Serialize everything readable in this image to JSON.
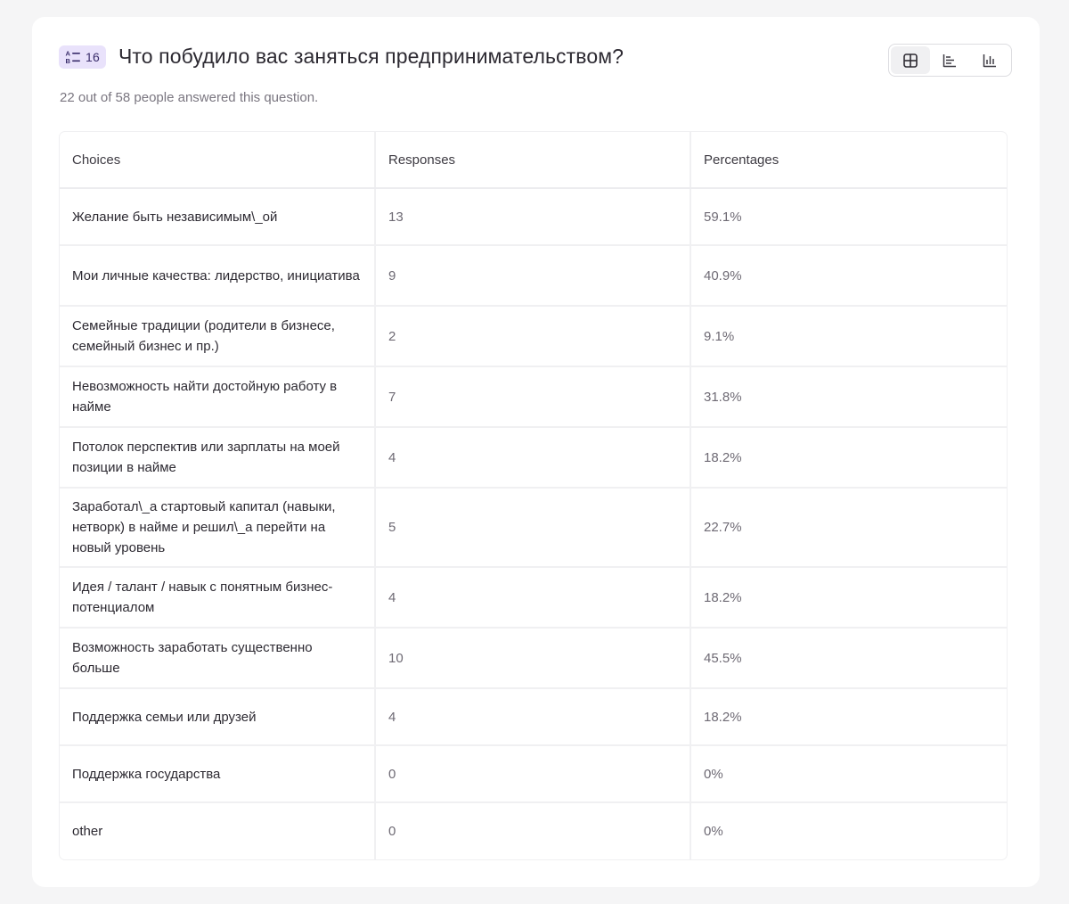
{
  "question": {
    "number": "16",
    "title": "Что побудило вас заняться предпринимательством?",
    "summary": "22 out of 58 people answered this question."
  },
  "view_switch": {
    "active": "table",
    "options": [
      "table",
      "horizontal-bar",
      "vertical-bar"
    ]
  },
  "table": {
    "headers": [
      "Choices",
      "Responses",
      "Percentages"
    ],
    "rows": [
      {
        "choice": "Желание быть независимым\\_ой",
        "responses": "13",
        "percentage": "59.1%"
      },
      {
        "choice": "Мои личные качества: лидерство, инициатива",
        "responses": "9",
        "percentage": "40.9%"
      },
      {
        "choice": "Семейные традиции (родители в бизнесе, семейный бизнес и пр.)",
        "responses": "2",
        "percentage": "9.1%"
      },
      {
        "choice": "Невозможность найти достойную работу в найме",
        "responses": "7",
        "percentage": "31.8%"
      },
      {
        "choice": "Потолок перспектив или зарплаты на моей позиции в найме",
        "responses": "4",
        "percentage": "18.2%"
      },
      {
        "choice": "Заработал\\_а стартовый капитал (навыки, нетворк) в найме и решил\\_а перейти на новый уровень",
        "responses": "5",
        "percentage": "22.7%"
      },
      {
        "choice": "Идея / талант / навык с понятным бизнес-потенциалом",
        "responses": "4",
        "percentage": "18.2%"
      },
      {
        "choice": "Возможность заработать существенно больше",
        "responses": "10",
        "percentage": "45.5%"
      },
      {
        "choice": "Поддержка семьи или друзей",
        "responses": "4",
        "percentage": "18.2%"
      },
      {
        "choice": "Поддержка государства",
        "responses": "0",
        "percentage": "0%"
      },
      {
        "choice": "other",
        "responses": "0",
        "percentage": "0%"
      }
    ]
  }
}
